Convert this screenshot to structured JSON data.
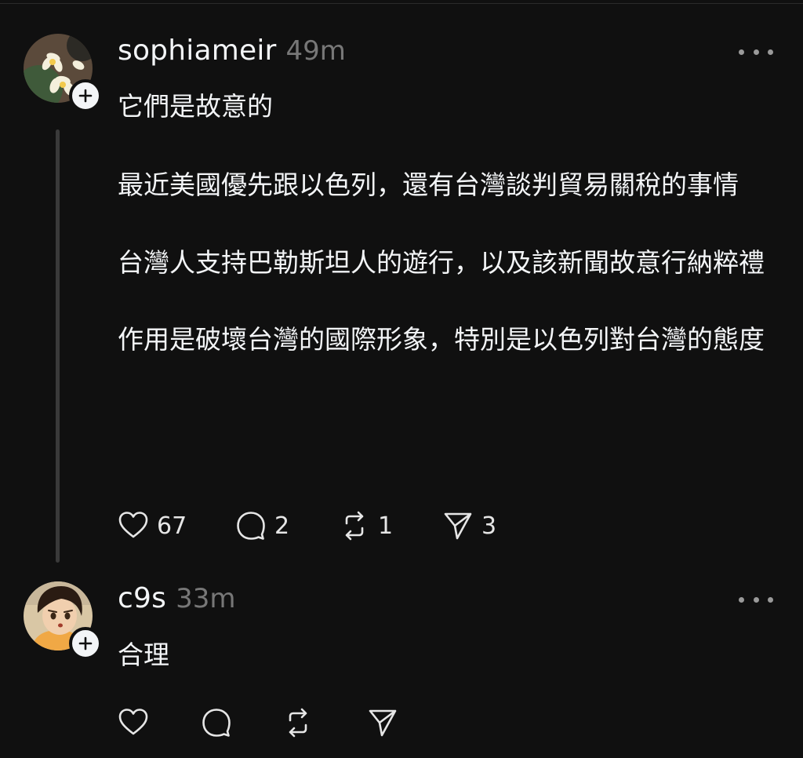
{
  "posts": [
    {
      "username": "sophiameir",
      "timestamp": "49m",
      "paragraphs": [
        "它們是故意的",
        "最近美國優先跟以色列，還有台灣談判貿易關稅的事情",
        "台灣人支持巴勒斯坦人的遊行，以及該新聞故意行納粹禮",
        "作用是破壞台灣的國際形象，特別是以色列對台灣的態度"
      ],
      "likes": "67",
      "comments": "2",
      "reposts": "1",
      "shares": "3"
    },
    {
      "username": "c9s",
      "timestamp": "33m",
      "paragraphs": [
        "合理"
      ]
    }
  ],
  "icons": {
    "like": "heart-icon",
    "comment": "comment-bubble-icon",
    "repost": "repost-icon",
    "share": "send-icon",
    "more": "more-dots-icon",
    "follow": "plus-icon"
  },
  "colors": {
    "background": "#101010",
    "text": "#f3f5f7",
    "secondary": "#777777",
    "thread_line": "#3a3a3a"
  }
}
